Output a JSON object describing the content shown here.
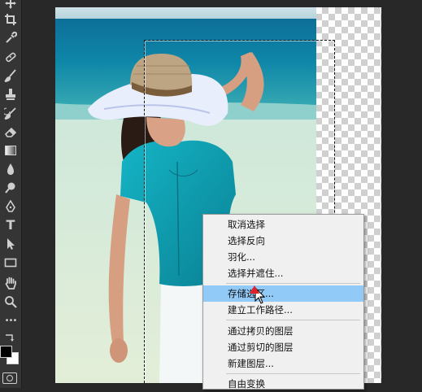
{
  "tools": [
    {
      "name": "move-icon"
    },
    {
      "name": "crop-icon"
    },
    {
      "name": "eyedropper-icon"
    },
    {
      "name": "healing-brush-icon"
    },
    {
      "name": "brush-icon"
    },
    {
      "name": "clone-stamp-icon"
    },
    {
      "name": "history-brush-icon"
    },
    {
      "name": "eraser-icon"
    },
    {
      "name": "gradient-icon"
    },
    {
      "name": "blur-icon"
    },
    {
      "name": "dodge-icon"
    },
    {
      "name": "pen-icon"
    },
    {
      "name": "type-icon",
      "glyph": "T"
    },
    {
      "name": "path-selection-icon"
    },
    {
      "name": "rectangle-icon"
    },
    {
      "name": "hand-icon"
    },
    {
      "name": "zoom-icon"
    },
    {
      "name": "more-tools-icon",
      "glyph": "•••"
    }
  ],
  "colors": {
    "foreground": "#000000",
    "background": "#ffffff",
    "menu_highlight": "#91c9f7"
  },
  "context_menu": {
    "items": [
      {
        "label": "取消选择"
      },
      {
        "label": "选择反向"
      },
      {
        "label": "羽化..."
      },
      {
        "label": "选择并遮住..."
      },
      {
        "label": "存储选区..."
      },
      {
        "label": "建立工作路径..."
      },
      {
        "label": "通过拷贝的图层"
      },
      {
        "label": "通过剪切的图层"
      },
      {
        "label": "新建图层..."
      },
      {
        "label": "自由变换"
      }
    ],
    "highlighted_index": 4
  }
}
